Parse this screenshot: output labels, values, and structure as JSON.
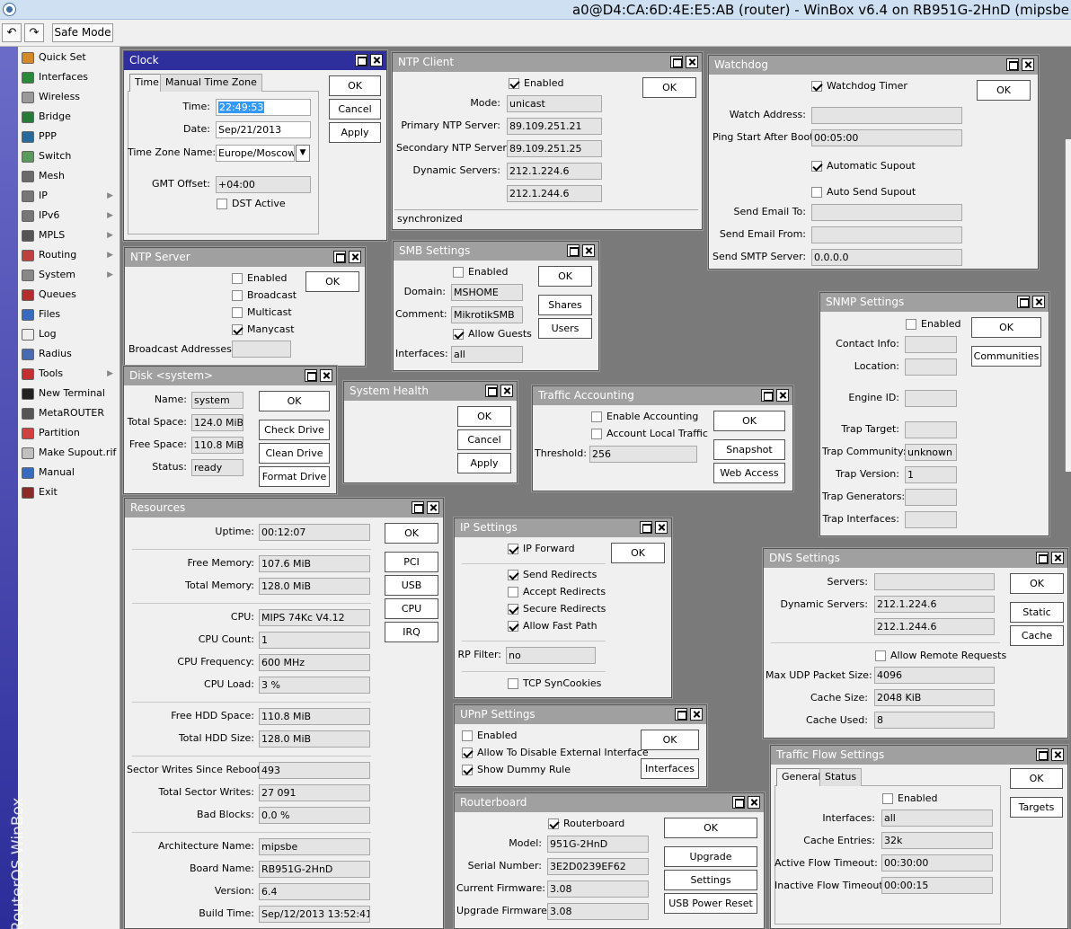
{
  "titlebar": {
    "title": "a0@D4:CA:6D:4E:E5:AB (router) - WinBox v6.4 on RB951G-2HnD (mipsbe"
  },
  "toolbar": {
    "safe_mode": "Safe Mode",
    "undo_icon": "undo-icon",
    "redo_icon": "redo-icon"
  },
  "sidebar": {
    "brand": "RouterOS WinBox",
    "items": [
      {
        "label": "Quick Set",
        "icon": "quick-set-icon",
        "color": "#d08a2c"
      },
      {
        "label": "Interfaces",
        "icon": "interfaces-icon",
        "color": "#2a8a3a"
      },
      {
        "label": "Wireless",
        "icon": "wireless-icon",
        "color": "#9a9a9a"
      },
      {
        "label": "Bridge",
        "icon": "bridge-icon",
        "color": "#2a7a3a"
      },
      {
        "label": "PPP",
        "icon": "ppp-icon",
        "color": "#2a6a9a"
      },
      {
        "label": "Switch",
        "icon": "switch-icon",
        "color": "#5a9a5a"
      },
      {
        "label": "Mesh",
        "icon": "mesh-icon",
        "color": "#6a6a6a"
      },
      {
        "label": "IP",
        "icon": "ip-icon",
        "color": "#777777",
        "arrow": true
      },
      {
        "label": "IPv6",
        "icon": "ipv6-icon",
        "color": "#777777",
        "arrow": true
      },
      {
        "label": "MPLS",
        "icon": "mpls-icon",
        "color": "#555555",
        "arrow": true
      },
      {
        "label": "Routing",
        "icon": "routing-icon",
        "color": "#c04040",
        "arrow": true
      },
      {
        "label": "System",
        "icon": "system-icon",
        "color": "#888888",
        "arrow": true
      },
      {
        "label": "Queues",
        "icon": "queues-icon",
        "color": "#b03030"
      },
      {
        "label": "Files",
        "icon": "files-icon",
        "color": "#3a6ac0"
      },
      {
        "label": "Log",
        "icon": "log-icon",
        "color": "#eeeeee"
      },
      {
        "label": "Radius",
        "icon": "radius-icon",
        "color": "#4a6ab0"
      },
      {
        "label": "Tools",
        "icon": "tools-icon",
        "color": "#c03030",
        "arrow": true
      },
      {
        "label": "New Terminal",
        "icon": "terminal-icon",
        "color": "#222222"
      },
      {
        "label": "MetaROUTER",
        "icon": "metarouter-icon",
        "color": "#555555"
      },
      {
        "label": "Partition",
        "icon": "partition-icon",
        "color": "#d04040"
      },
      {
        "label": "Make Supout.rif",
        "icon": "supout-icon",
        "color": "#c0c0c0"
      },
      {
        "label": "Manual",
        "icon": "manual-icon",
        "color": "#3a6ac0"
      },
      {
        "label": "Exit",
        "icon": "exit-icon",
        "color": "#8a2a2a"
      }
    ]
  },
  "clock": {
    "title": "Clock",
    "tab_time": "Time",
    "tab_tz": "Manual Time Zone",
    "time_label": "Time:",
    "time": "22:49:53",
    "date_label": "Date:",
    "date": "Sep/21/2013",
    "tz_label": "Time Zone Name:",
    "tz": "Europe/Moscow",
    "gmt_label": "GMT Offset:",
    "gmt": "+04:00",
    "dst": "DST Active",
    "ok": "OK",
    "cancel": "Cancel",
    "apply": "Apply"
  },
  "ntp_client": {
    "title": "NTP Client",
    "enabled": "Enabled",
    "mode_label": "Mode:",
    "mode": "unicast",
    "primary_label": "Primary NTP Server:",
    "primary": "89.109.251.21",
    "secondary_label": "Secondary NTP Server:",
    "secondary": "89.109.251.25",
    "dyn_label": "Dynamic Servers:",
    "dyn1": "212.1.224.6",
    "dyn2": "212.1.244.6",
    "status": "synchronized",
    "ok": "OK"
  },
  "watchdog": {
    "title": "Watchdog",
    "timer": "Watchdog Timer",
    "watch_label": "Watch Address:",
    "watch": "",
    "ping_label": "Ping Start After Boot:",
    "ping": "00:05:00",
    "auto_supout": "Automatic Supout",
    "auto_send": "Auto Send Supout",
    "email_to_label": "Send Email To:",
    "email_to": "",
    "email_from_label": "Send Email From:",
    "email_from": "",
    "smtp_label": "Send SMTP Server:",
    "smtp": "0.0.0.0",
    "ok": "OK"
  },
  "ntp_server": {
    "title": "NTP Server",
    "enabled": "Enabled",
    "broadcast": "Broadcast",
    "multicast": "Multicast",
    "manycast": "Manycast",
    "bcast_label": "Broadcast Addresses:",
    "bcast": "",
    "ok": "OK"
  },
  "smb": {
    "title": "SMB Settings",
    "enabled": "Enabled",
    "domain_label": "Domain:",
    "domain": "MSHOME",
    "comment_label": "Comment:",
    "comment": "MikrotikSMB",
    "guests": "Allow Guests",
    "ifaces_label": "Interfaces:",
    "ifaces": "all",
    "ok": "OK",
    "shares": "Shares",
    "users": "Users"
  },
  "disk": {
    "title": "Disk <system>",
    "name_label": "Name:",
    "name": "system",
    "total_label": "Total Space:",
    "total": "124.0 MiB",
    "free_label": "Free Space:",
    "free": "110.8 MiB",
    "status_label": "Status:",
    "status": "ready",
    "ok": "OK",
    "check": "Check Drive",
    "clean": "Clean Drive",
    "format": "Format Drive"
  },
  "health": {
    "title": "System Health",
    "ok": "OK",
    "cancel": "Cancel",
    "apply": "Apply"
  },
  "traffic": {
    "title": "Traffic Accounting",
    "enable": "Enable Accounting",
    "local": "Account Local Traffic",
    "threshold_label": "Threshold:",
    "threshold": "256",
    "ok": "OK",
    "snapshot": "Snapshot",
    "web": "Web Access"
  },
  "snmp": {
    "title": "SNMP Settings",
    "enabled": "Enabled",
    "contact_label": "Contact Info:",
    "location_label": "Location:",
    "engine_label": "Engine ID:",
    "trap_target_label": "Trap Target:",
    "trap_comm_label": "Trap Community:",
    "trap_comm": "unknown",
    "trap_ver_label": "Trap Version:",
    "trap_ver": "1",
    "trap_gen_label": "Trap Generators:",
    "trap_if_label": "Trap Interfaces:",
    "ok": "OK",
    "communities": "Communities"
  },
  "resources": {
    "title": "Resources",
    "rows": [
      {
        "label": "Uptime:",
        "value": "00:12:07"
      },
      {
        "label": "Free Memory:",
        "value": "107.6 MiB"
      },
      {
        "label": "Total Memory:",
        "value": "128.0 MiB"
      },
      {
        "label": "CPU:",
        "value": "MIPS 74Kc V4.12"
      },
      {
        "label": "CPU Count:",
        "value": "1"
      },
      {
        "label": "CPU Frequency:",
        "value": "600 MHz"
      },
      {
        "label": "CPU Load:",
        "value": "3 %"
      },
      {
        "label": "Free HDD Space:",
        "value": "110.8 MiB"
      },
      {
        "label": "Total HDD Size:",
        "value": "128.0 MiB"
      },
      {
        "label": "Sector Writes Since Reboot:",
        "value": "493"
      },
      {
        "label": "Total Sector Writes:",
        "value": "27 091"
      },
      {
        "label": "Bad Blocks:",
        "value": "0.0 %"
      },
      {
        "label": "Architecture Name:",
        "value": "mipsbe"
      },
      {
        "label": "Board Name:",
        "value": "RB951G-2HnD"
      },
      {
        "label": "Version:",
        "value": "6.4"
      },
      {
        "label": "Build Time:",
        "value": "Sep/12/2013 13:52:41"
      }
    ],
    "ok": "OK",
    "pci": "PCI",
    "usb": "USB",
    "cpu": "CPU",
    "irq": "IRQ"
  },
  "ip_settings": {
    "title": "IP Settings",
    "forward": "IP Forward",
    "send_redirects": "Send Redirects",
    "accept_redirects": "Accept Redirects",
    "secure_redirects": "Secure Redirects",
    "fast_path": "Allow Fast Path",
    "rp_label": "RP Filter:",
    "rp": "no",
    "syncookies": "TCP SynCookies",
    "ok": "OK"
  },
  "dns": {
    "title": "DNS Settings",
    "servers_label": "Servers:",
    "servers": "",
    "dyn_label": "Dynamic Servers:",
    "dyn1": "212.1.224.6",
    "dyn2": "212.1.244.6",
    "remote": "Allow Remote Requests",
    "udp_label": "Max UDP Packet Size:",
    "udp": "4096",
    "cache_size_label": "Cache Size:",
    "cache_size": "2048 KiB",
    "cache_used_label": "Cache Used:",
    "cache_used": "8",
    "ok": "OK",
    "static": "Static",
    "cache": "Cache"
  },
  "upnp": {
    "title": "UPnP Settings",
    "enabled": "Enabled",
    "disable_ext": "Allow To Disable External Interface",
    "dummy": "Show Dummy Rule",
    "ok": "OK",
    "interfaces": "Interfaces"
  },
  "routerboard": {
    "title": "Routerboard",
    "rb": "Routerboard",
    "model_label": "Model:",
    "model": "951G-2HnD",
    "serial_label": "Serial Number:",
    "serial": "3E2D0239EF62",
    "cur_fw_label": "Current Firmware:",
    "cur_fw": "3.08",
    "up_fw_label": "Upgrade Firmware:",
    "up_fw": "3.08",
    "ok": "OK",
    "upgrade": "Upgrade",
    "settings": "Settings",
    "usb_reset": "USB Power Reset"
  },
  "traffic_flow": {
    "title": "Traffic Flow Settings",
    "tab_general": "General",
    "tab_status": "Status",
    "enabled": "Enabled",
    "ifaces_label": "Interfaces:",
    "ifaces": "all",
    "entries_label": "Cache Entries:",
    "entries": "32k",
    "active_label": "Active Flow Timeout:",
    "active": "00:30:00",
    "inactive_label": "Inactive Flow Timeout:",
    "inactive": "00:00:15",
    "ok": "OK",
    "targets": "Targets"
  }
}
